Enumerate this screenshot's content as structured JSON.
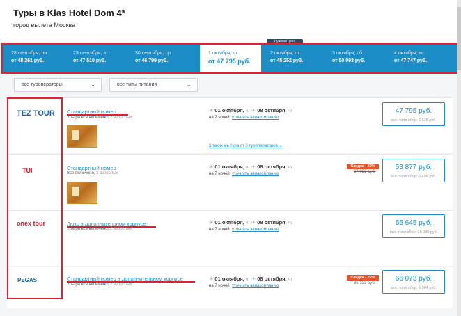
{
  "header": {
    "title": "Туры в Klas Hotel Dom 4*",
    "subtitle": "город вылета Москва"
  },
  "best_tag": "Лучшая цена",
  "dates": [
    {
      "date": "28 сентября, пн",
      "price": "от 48 261 руб."
    },
    {
      "date": "29 сентября, вт",
      "price": "от 47 510 руб."
    },
    {
      "date": "30 сентября, ср",
      "price": "от 46 799 руб."
    },
    {
      "date": "1 октября, чт",
      "price": "от 47 795 руб.",
      "active": true
    },
    {
      "date": "2 октября, пт",
      "price": "от 45 252 руб."
    },
    {
      "date": "3 октября, сб",
      "price": "от 50 093 руб."
    },
    {
      "date": "4 октября, вс",
      "price": "от 47 747 руб."
    }
  ],
  "filters": {
    "operators": "все туроператоры",
    "meals": "все типы питания"
  },
  "tours": [
    {
      "operator": "TEZ TOUR",
      "room": "Стандартный номер",
      "meal": "Ультра все включено,",
      "guests": "2 взрослых",
      "dep": "01 октября,",
      "dep_dow": "чт",
      "ret": "08 октября,",
      "ret_dow": "чт",
      "nights": "на 7 ночей,",
      "flight_link": "уточнить авиакомпанию",
      "price": "47 795 руб.",
      "fee": "вкл. топл сбор: 6 528 руб.",
      "more": "3 таких же тура от 3 туроператоров"
    },
    {
      "operator": "TUI",
      "room": "Стандартный номер",
      "meal": "Все включено,",
      "guests": "2 взрослых",
      "dep": "01 октября,",
      "dep_dow": "чт",
      "ret": "08 октября,",
      "ret_dow": "чт",
      "nights": "на 7 ночей,",
      "flight_link": "уточнить авиакомпанию",
      "discount": "Скидка - 20%",
      "old_price": "67 033 руб.",
      "price": "53 877 руб.",
      "fee": "вкл. топл сбор: 6 496 руб."
    },
    {
      "operator": "onex tour",
      "room": "Люкс в дополнительном корпусе",
      "meal": "Ультра все включено,",
      "guests": "2 взрослых",
      "dep": "01 октября,",
      "dep_dow": "чт",
      "ret": "08 октября,",
      "ret_dow": "чт",
      "nights": "на 7 ночей,",
      "flight_link": "уточнить авиакомпанию",
      "price": "65 645 руб.",
      "fee": "вкл. топл сбор: 16 080 руб."
    },
    {
      "operator": "PEGAS",
      "room": "Стандартный номер в дополнительном корпусе",
      "meal": "Ультра все включено,",
      "guests": "2 взрослых",
      "dep": "01 октября,",
      "dep_dow": "чт",
      "ret": "08 октября,",
      "ret_dow": "чт",
      "nights": "на 7 ночей,",
      "flight_link": "уточнить авиакомпанию",
      "discount": "Скидка - 22%",
      "old_price": "85 133 руб.",
      "price": "66 073 руб.",
      "fee": "вкл. топл сбор: 6 504 руб."
    }
  ]
}
